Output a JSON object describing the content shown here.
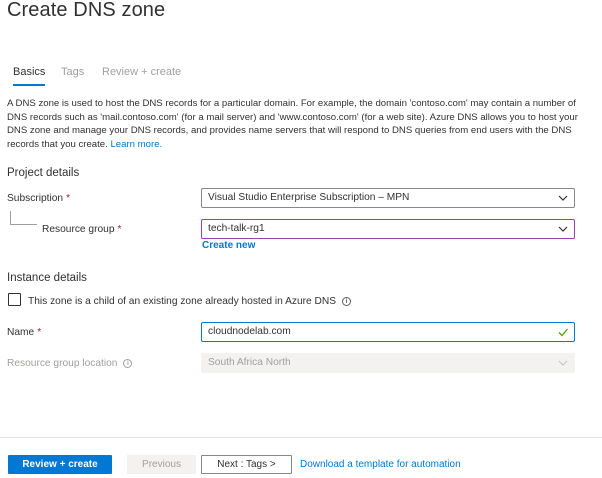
{
  "header": {
    "title": "Create DNS zone"
  },
  "tabs": [
    {
      "label": "Basics",
      "active": true
    },
    {
      "label": "Tags",
      "active": false
    },
    {
      "label": "Review + create",
      "active": false
    }
  ],
  "description": {
    "text": "A DNS zone is used to host the DNS records for a particular domain. For example, the domain 'contoso.com' may contain a number of DNS records such as 'mail.contoso.com' (for a mail server) and 'www.contoso.com' (for a web site). Azure DNS allows you to host your DNS zone and manage your DNS records, and provides name servers that will respond to DNS queries from end users with the DNS records that you create.",
    "link": "Learn more."
  },
  "project_details": {
    "heading": "Project details",
    "subscription_label": "Subscription",
    "subscription_value": "Visual Studio Enterprise Subscription – MPN",
    "resource_group_label": "Resource group",
    "resource_group_value": "tech-talk-rg1",
    "create_new": "Create new",
    "required_marker": "*"
  },
  "instance_details": {
    "heading": "Instance details",
    "child_zone_label": "This zone is a child of an existing zone already hosted in Azure DNS",
    "child_zone_checked": false,
    "name_label": "Name",
    "name_value": "cloudnodelab.com",
    "location_label": "Resource group location",
    "location_value": "South Africa North"
  },
  "footer": {
    "review_create": "Review + create",
    "previous": "Previous",
    "next": "Next : Tags >",
    "download_link": "Download a template for automation"
  },
  "colors": {
    "accent": "#0078d4",
    "required": "#a4262c",
    "focus_border": "#9a3fb5",
    "valid_check": "#57a300"
  }
}
